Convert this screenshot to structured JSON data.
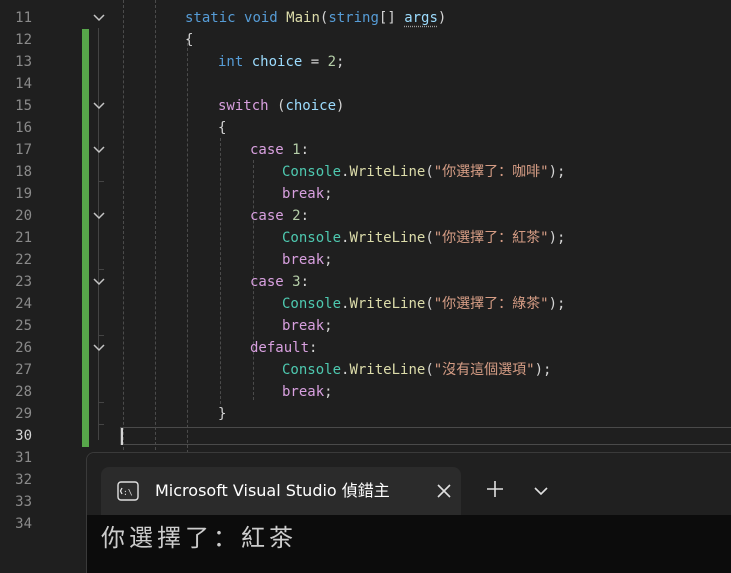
{
  "editor": {
    "current_line": "30",
    "line_numbers": [
      "11",
      "12",
      "13",
      "14",
      "15",
      "16",
      "17",
      "18",
      "19",
      "20",
      "21",
      "22",
      "23",
      "24",
      "25",
      "26",
      "27",
      "28",
      "29",
      "30",
      "31",
      "32",
      "33",
      "34"
    ],
    "code": {
      "l11": {
        "kw1": "static",
        "kw2": "void",
        "method": "Main",
        "p1": "(",
        "type": "string",
        "p2": "[] ",
        "param": "args",
        "p3": ")"
      },
      "l12": {
        "brace": "{"
      },
      "l13": {
        "type": "int",
        "var": " choice",
        "eq": " = ",
        "num": "2",
        "semi": ";"
      },
      "l15": {
        "kw": "switch",
        "p1": " (",
        "var": "choice",
        "p2": ")"
      },
      "l16": {
        "brace": "{"
      },
      "l17": {
        "kw": "case",
        "num": " 1",
        "colon": ":"
      },
      "l18": {
        "cls": "Console",
        "dot": ".",
        "method": "WriteLine",
        "p1": "(",
        "str": "\"你選擇了：咖啡\"",
        "p2": ");"
      },
      "l19": {
        "kw": "break",
        "semi": ";"
      },
      "l20": {
        "kw": "case",
        "num": " 2",
        "colon": ":"
      },
      "l21": {
        "cls": "Console",
        "dot": ".",
        "method": "WriteLine",
        "p1": "(",
        "str": "\"你選擇了：紅茶\"",
        "p2": ");"
      },
      "l22": {
        "kw": "break",
        "semi": ";"
      },
      "l23": {
        "kw": "case",
        "num": " 3",
        "colon": ":"
      },
      "l24": {
        "cls": "Console",
        "dot": ".",
        "method": "WriteLine",
        "p1": "(",
        "str": "\"你選擇了：綠茶\"",
        "p2": ");"
      },
      "l25": {
        "kw": "break",
        "semi": ";"
      },
      "l26": {
        "kw": "default",
        "colon": ":"
      },
      "l27": {
        "cls": "Console",
        "dot": ".",
        "method": "WriteLine",
        "p1": "(",
        "str": "\"沒有這個選項\"",
        "p2": ");"
      },
      "l28": {
        "kw": "break",
        "semi": ";"
      },
      "l29": {
        "brace": "}"
      }
    }
  },
  "colors": {
    "keyword": "#569cd6",
    "control": "#d8a0df",
    "class": "#4ec9b0",
    "method": "#dcdcaa",
    "string": "#d69d85",
    "number": "#b5cea8",
    "variable": "#9cdcfe",
    "change_bar": "#57a64a"
  },
  "icons": {
    "fold": "chevron-down-icon",
    "console": "console-icon",
    "close": "close-icon",
    "add": "plus-icon",
    "dropdown": "chevron-down-icon"
  },
  "terminal": {
    "tab_title": "Microsoft Visual Studio 偵錯主",
    "output": "你選擇了：紅茶"
  }
}
